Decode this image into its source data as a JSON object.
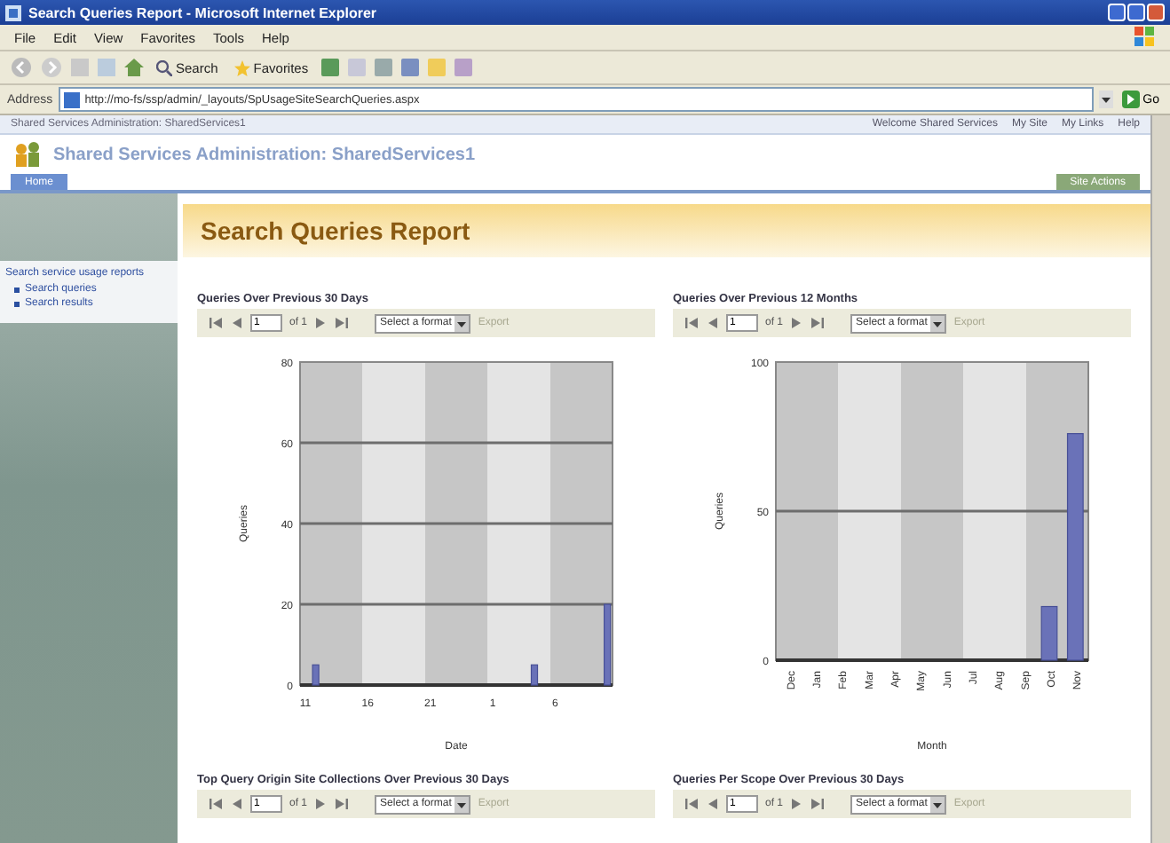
{
  "window": {
    "title": "Search Queries Report - Microsoft Internet Explorer"
  },
  "menu": [
    "File",
    "Edit",
    "View",
    "Favorites",
    "Tools",
    "Help"
  ],
  "toolbar": [
    "Search",
    "Favorites"
  ],
  "address": {
    "label": "Address",
    "value": "http://mo-fs/ssp/admin/_layouts/SpUsageSiteSearchQueries.aspx",
    "go": "Go"
  },
  "top_bar": {
    "breadcrumb": "Shared Services Administration: SharedServices1",
    "links": [
      "Welcome Shared Services",
      "My Site",
      "My Links",
      "Help"
    ]
  },
  "site": {
    "title": "Shared Services Administration: SharedServices1",
    "tabs": [
      {
        "label": "Home",
        "selected": true
      }
    ],
    "action": "Site Actions"
  },
  "sidebar": {
    "heading": "Search service usage reports",
    "items": [
      "Search queries",
      "Search results"
    ]
  },
  "page_title": "Search Queries Report",
  "reports": [
    {
      "title": "Queries Over Previous 30 Days",
      "page": "1",
      "of": "of 1",
      "format": "Select a format",
      "export": "Export",
      "chart_data": {
        "type": "bar",
        "xlabel": "Date",
        "ylabel": "Queries",
        "categories": [
          "11",
          null,
          null,
          null,
          null,
          null,
          "16",
          null,
          null,
          null,
          null,
          null,
          "21",
          null,
          null,
          null,
          null,
          null,
          "1",
          null,
          null,
          null,
          null,
          null,
          "6",
          null,
          null,
          null,
          null,
          null
        ],
        "values": [
          null,
          5,
          null,
          null,
          null,
          null,
          null,
          null,
          null,
          null,
          null,
          null,
          null,
          null,
          null,
          null,
          null,
          null,
          null,
          null,
          null,
          null,
          5,
          null,
          null,
          null,
          null,
          null,
          null,
          20
        ],
        "ylim": [
          0,
          80
        ],
        "yticks": [
          0,
          20,
          40,
          60,
          80
        ],
        "grid": true
      }
    },
    {
      "title": "Queries Over Previous 12 Months",
      "page": "1",
      "of": "of 1",
      "format": "Select a format",
      "export": "Export",
      "chart_data": {
        "type": "bar",
        "xlabel": "Month",
        "ylabel": "Queries",
        "categories": [
          "Dec",
          "Jan",
          "Feb",
          "Mar",
          "Apr",
          "May",
          "Jun",
          "Jul",
          "Aug",
          "Sep",
          "Oct",
          "Nov"
        ],
        "values": [
          0,
          0,
          0,
          0,
          0,
          0,
          0,
          0,
          0,
          0,
          18,
          76
        ],
        "ylim": [
          0,
          100
        ],
        "yticks": [
          0,
          50,
          100
        ],
        "grid": true
      }
    },
    {
      "title": "Top Query Origin Site Collections Over Previous 30 Days",
      "page": "1",
      "of": "of 1",
      "format": "Select a format",
      "export": "Export"
    },
    {
      "title": "Queries Per Scope Over Previous 30 Days",
      "page": "1",
      "of": "of 1",
      "format": "Select a format",
      "export": "Export"
    }
  ]
}
